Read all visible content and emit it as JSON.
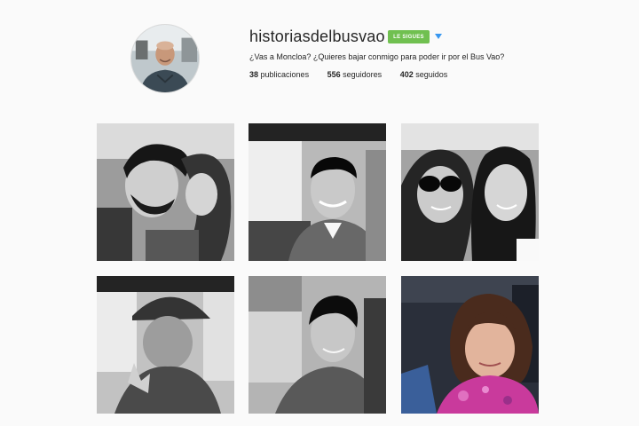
{
  "profile": {
    "username": "historiasdelbusvao",
    "follow_status": "LE SIGUES",
    "bio": "¿Vas a Moncloa? ¿Quieres bajar conmigo para poder ir por el Bus Vao?",
    "stats": {
      "posts_count": "38",
      "posts_label": "publicaciones",
      "followers_count": "556",
      "followers_label": "seguidores",
      "following_count": "402",
      "following_label": "seguidos"
    }
  },
  "colors": {
    "page_background": "#fafafa",
    "follow_badge": "#70c050",
    "dropdown_arrow": "#3897f0"
  },
  "icons": {
    "dropdown": "triangle-down-icon"
  },
  "grid": {
    "columns": 3,
    "rows": 2,
    "posts": [
      {
        "style": "black-and-white"
      },
      {
        "style": "black-and-white"
      },
      {
        "style": "black-and-white"
      },
      {
        "style": "black-and-white"
      },
      {
        "style": "black-and-white"
      },
      {
        "style": "color"
      }
    ]
  }
}
